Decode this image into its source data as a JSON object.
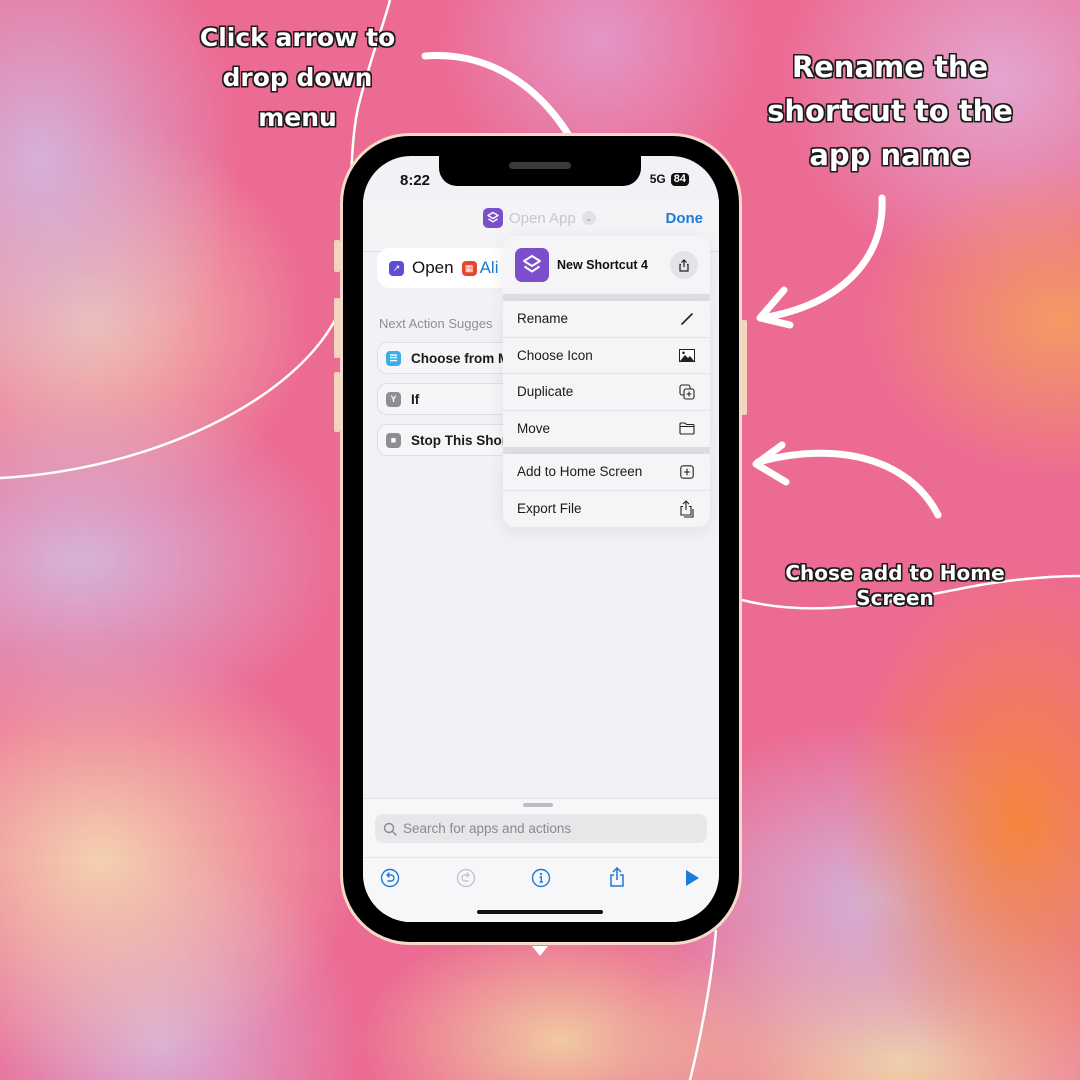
{
  "annotations": {
    "dropdown_note": "Click arrow to drop down menu",
    "rename_note": "Rename the shortcut to the app name",
    "home_note": "Chose add to Home Screen"
  },
  "status_bar": {
    "time": "8:22",
    "network": "5G",
    "battery": "84"
  },
  "nav": {
    "title": "Open App",
    "title_icon": "shortcuts-layers-icon",
    "chevron_icon": "chevron-down-icon",
    "done_label": "Done"
  },
  "editor": {
    "action": {
      "verb": "Open",
      "app_name": "Ali"
    },
    "suggestions_header": "Next Action Sugges",
    "suggestions": [
      {
        "label": "Choose from M",
        "icon": "menu-list-icon",
        "color": "#3aaee8"
      },
      {
        "label": "If",
        "icon": "branch-icon",
        "color": "#8e8e93"
      },
      {
        "label": "Stop This Shor",
        "icon": "stop-square-icon",
        "color": "#8e8e93"
      }
    ]
  },
  "menu": {
    "shortcut_name": "New Shortcut 4",
    "group1": [
      {
        "label": "Rename",
        "icon": "pencil-icon"
      },
      {
        "label": "Choose Icon",
        "icon": "photo-icon"
      },
      {
        "label": "Duplicate",
        "icon": "duplicate-icon"
      },
      {
        "label": "Move",
        "icon": "folder-icon"
      }
    ],
    "group2": [
      {
        "label": "Add to Home Screen",
        "icon": "plus-square-icon"
      },
      {
        "label": "Export File",
        "icon": "export-icon"
      }
    ]
  },
  "bottom": {
    "search_placeholder": "Search for apps and actions"
  },
  "colors": {
    "accent_blue": "#1d7ad6",
    "shortcut_purple": "#7b4fc9",
    "background_pink": "#ec6b93"
  }
}
